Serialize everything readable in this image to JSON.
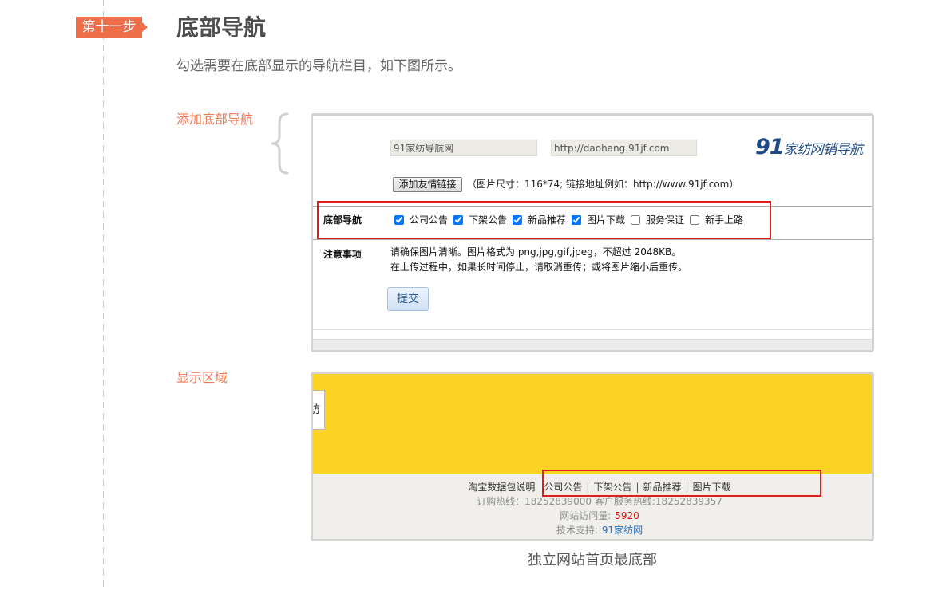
{
  "step": {
    "badge": "第十一步",
    "title": "底部导航",
    "subtitle": "勾选需要在底部显示的导航栏目，如下图所示。"
  },
  "section_add": {
    "label": "添加底部导航"
  },
  "form": {
    "site_name_value": "91家纺导航网",
    "site_url_value": "http://daohang.91jf.com",
    "logo": {
      "num": "91",
      "text": "家纺网销导航"
    },
    "add_link_button": "添加友情链接",
    "add_link_hint": "（图片尺寸：116*74; 链接地址例如：http://www.91jf.com）",
    "bottom_nav_label": "底部导航",
    "nav_options": [
      {
        "label": "公司公告",
        "checked": true
      },
      {
        "label": "下架公告",
        "checked": true
      },
      {
        "label": "新品推荐",
        "checked": true
      },
      {
        "label": "图片下载",
        "checked": true
      },
      {
        "label": "服务保证",
        "checked": false
      },
      {
        "label": "新手上路",
        "checked": false
      }
    ],
    "notes_label": "注意事项",
    "notes": [
      "请确保图片清晰。图片格式为 png,jpg,gif,jpeg，不超过 2048KB。",
      "在上传过程中，如果长时间停止，请取消重传；或将图片缩小后重传。"
    ],
    "submit_button": "提交"
  },
  "section_display": {
    "label": "显示区域"
  },
  "preview": {
    "side_fragment": "纺",
    "footer_lead": "淘宝数据包说明",
    "footer_links": [
      "公司公告",
      "下架公告",
      "新品推荐",
      "图片下载"
    ],
    "separator": "|",
    "hotline": "订购热线：18252839000 客户服务热线:18252839357",
    "visits_label": "网站访问量:",
    "visits_count": "5920",
    "support_label": "技术支持:",
    "support_name": "91家纺网"
  },
  "caption": "独立网站首页最底部",
  "colors": {
    "badge": "#ee6e4a",
    "label": "#ef7b55",
    "highlight": "#de1d1d",
    "preview_yellow": "#fcd322",
    "visits": "#e4140f",
    "support": "#1f6fbf"
  }
}
